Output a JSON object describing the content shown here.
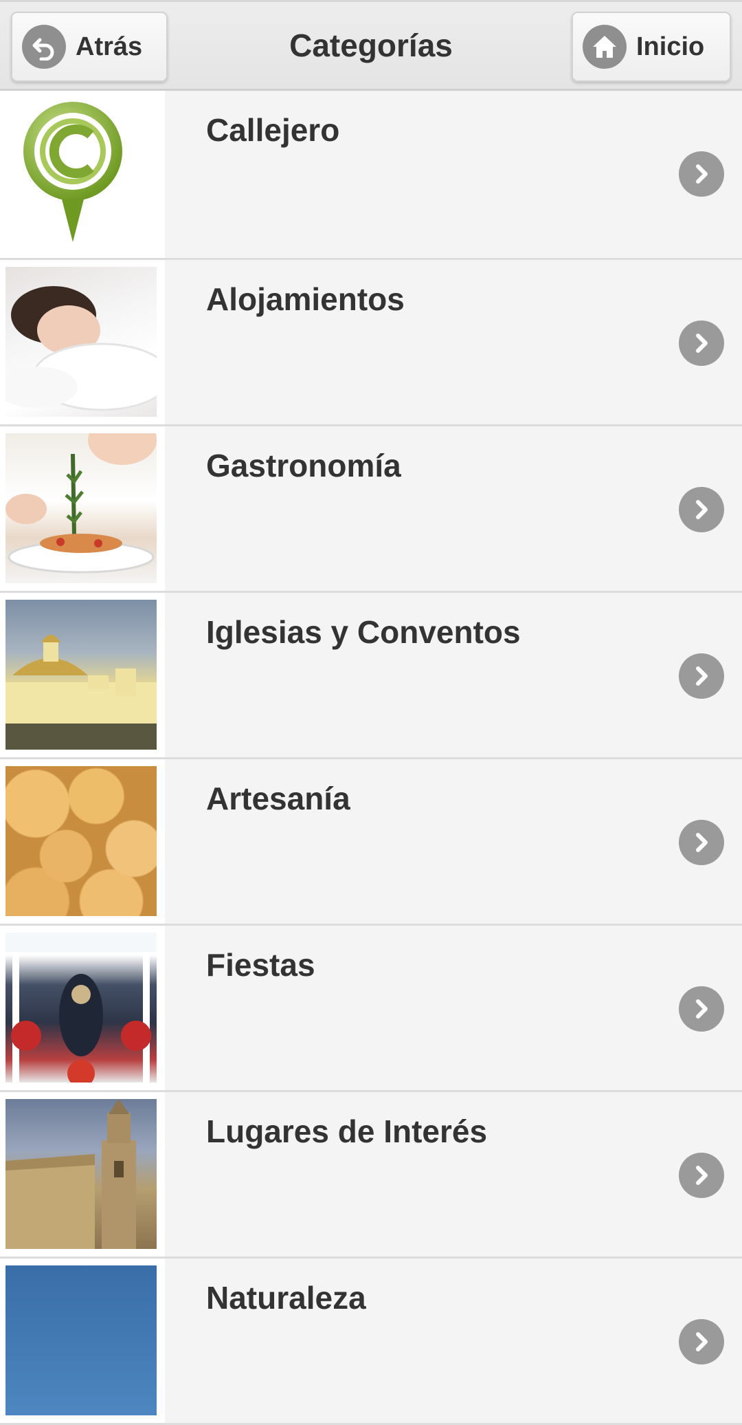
{
  "header": {
    "title": "Categorías",
    "back_label": "Atrás",
    "home_label": "Inicio"
  },
  "categories": [
    {
      "label": "Callejero",
      "icon": "map-pin-logo"
    },
    {
      "label": "Alojamientos",
      "icon": "sleeping-woman-photo"
    },
    {
      "label": "Gastronomía",
      "icon": "chef-dish-photo"
    },
    {
      "label": "Iglesias y Conventos",
      "icon": "church-photo"
    },
    {
      "label": "Artesanía",
      "icon": "pastries-photo"
    },
    {
      "label": "Fiestas",
      "icon": "procession-photo"
    },
    {
      "label": "Lugares de Interés",
      "icon": "bell-tower-photo"
    },
    {
      "label": "Naturaleza",
      "icon": "lake-photo"
    }
  ],
  "colors": {
    "background": "#f4f4f4",
    "header": "#e8e8e8",
    "icon_gray": "#9a9a9a",
    "logo_green": "#7fa832"
  }
}
